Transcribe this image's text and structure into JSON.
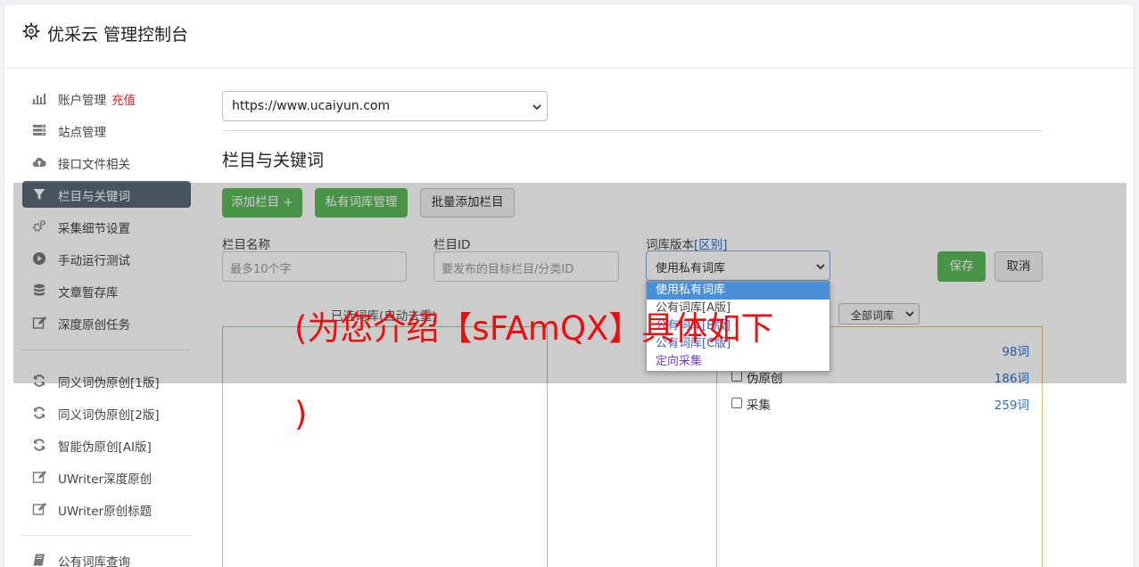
{
  "header": {
    "title": "优采云 管理控制台",
    "icon": "gear-icon"
  },
  "sidebar": {
    "groups": [
      [
        {
          "label": "账户管理",
          "tag": "充值",
          "icon": "bar-chart-icon"
        },
        {
          "label": "站点管理",
          "icon": "server-icon"
        },
        {
          "label": "接口文件相关",
          "icon": "cloud-upload-icon"
        },
        {
          "label": "栏目与关键词",
          "icon": "filter-icon",
          "active": true
        },
        {
          "label": "采集细节设置",
          "icon": "cogs-icon"
        },
        {
          "label": "手动运行测试",
          "icon": "play-circle-icon"
        },
        {
          "label": "文章暂存库",
          "icon": "database-icon"
        },
        {
          "label": "深度原创任务",
          "icon": "edit-icon"
        }
      ],
      [
        {
          "label": "同义词伪原创[1版]",
          "icon": "refresh-icon"
        },
        {
          "label": "同义词伪原创[2版]",
          "icon": "refresh-icon"
        },
        {
          "label": "智能伪原创[AI版]",
          "icon": "refresh-icon"
        },
        {
          "label": "UWriter深度原创",
          "icon": "edit-icon"
        },
        {
          "label": "UWriter原创标题",
          "icon": "edit-icon"
        }
      ],
      [
        {
          "label": "公有词库查询",
          "icon": "book-icon"
        }
      ]
    ]
  },
  "main": {
    "site_select": {
      "value": "https://www.ucaiyun.com"
    },
    "section_title": "栏目与关键词",
    "buttons": {
      "add_column": "添加栏目 +",
      "private_lib": "私有词库管理",
      "batch_add": "批量添加栏目",
      "save": "保存",
      "cancel": "取消"
    },
    "fields": {
      "column_name": {
        "label": "栏目名称",
        "placeholder": "最多10个字"
      },
      "column_id": {
        "label": "栏目ID",
        "placeholder": "要发布的目标栏目/分类ID"
      },
      "lib_version": {
        "label": "词库版本",
        "link": "[区别]",
        "value": "使用私有词库"
      }
    },
    "dropdown_options": [
      {
        "label": "使用私有词库",
        "style": "sel"
      },
      {
        "label": "公有词库[A版]",
        "style": "c1"
      },
      {
        "label": "公有词库[B版]",
        "style": "c2"
      },
      {
        "label": "公有词库[C版]",
        "style": "c2"
      },
      {
        "label": "定向采集",
        "style": "c3"
      }
    ],
    "chosen_label": "已选词库(自动去重)",
    "filter_select": {
      "value": "全部词库"
    },
    "libraries": [
      {
        "name": "",
        "count": "98词"
      },
      {
        "name": "伪原创",
        "count": "186词"
      },
      {
        "name": "采集",
        "count": "259词"
      }
    ]
  },
  "watermark": {
    "line1": "(为您介绍【sFAmQX】具体如下",
    "line2": ")"
  },
  "colors": {
    "primary_green": "#5cb85c",
    "active_nav": "#5b6878",
    "link": "#2a6fcf",
    "warning": "#e02020"
  }
}
